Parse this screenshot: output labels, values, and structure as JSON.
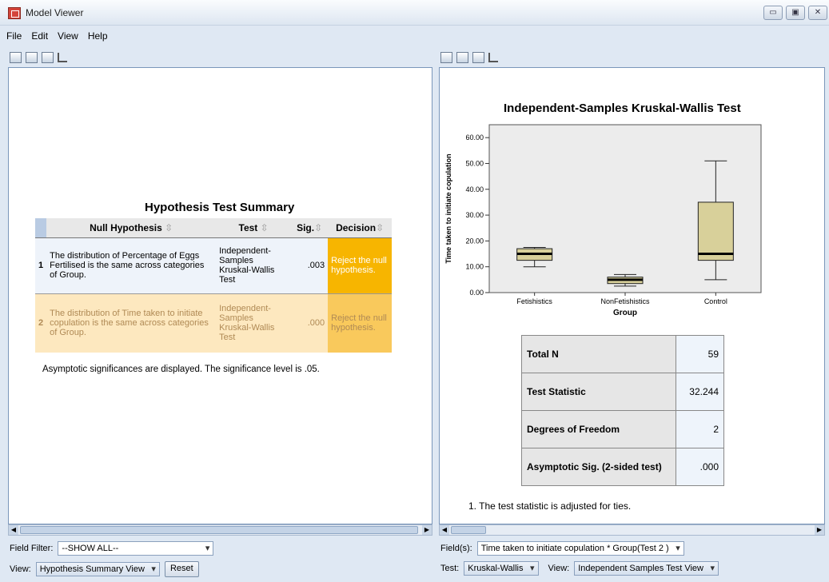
{
  "window": {
    "title": "Model Viewer",
    "controls": [
      "▭",
      "▣",
      "✕"
    ]
  },
  "menu": [
    "File",
    "Edit",
    "View",
    "Help"
  ],
  "left_pane": {
    "table_title": "Hypothesis Test Summary",
    "columns": [
      "Null Hypothesis",
      "Test",
      "Sig.",
      "Decision"
    ],
    "rows": [
      {
        "num": "1",
        "hypothesis": "The distribution of Percentage of Eggs Fertilised is the same across categories of Group.",
        "test": "Independent-Samples Kruskal-Wallis Test",
        "sig": ".003",
        "decision": "Reject the null hypothesis."
      },
      {
        "num": "2",
        "hypothesis": "The distribution of Time taken to initiate copulation is the same across categories of Group.",
        "test": "Independent-Samples Kruskal-Wallis Test",
        "sig": ".000",
        "decision": "Reject the null hypothesis."
      }
    ],
    "note": "Asymptotic significances are displayed.  The significance level is .05.",
    "field_filter_label": "Field Filter:",
    "field_filter_value": "--SHOW ALL--",
    "view_label": "View:",
    "view_value": "Hypothesis Summary View",
    "reset_label": "Reset"
  },
  "right_pane": {
    "chart_title": "Independent-Samples Kruskal-Wallis Test",
    "stats": [
      {
        "label": "Total N",
        "value": "59"
      },
      {
        "label": "Test Statistic",
        "value": "32.244"
      },
      {
        "label": "Degrees of Freedom",
        "value": "2"
      },
      {
        "label": "Asymptotic Sig. (2-sided test)",
        "value": ".000"
      }
    ],
    "footnote": "1.  The test statistic is adjusted for ties.",
    "fields_label": "Field(s):",
    "fields_value": "Time taken to initiate copulation * Group(Test 2 )",
    "test_label": "Test:",
    "test_value": "Kruskal-Wallis",
    "view_label": "View:",
    "view_value": "Independent Samples Test View"
  },
  "chart_data": {
    "type": "box",
    "title": "Independent-Samples Kruskal-Wallis Test",
    "xlabel": "Group",
    "ylabel": "Time taken to initiate copulation",
    "ylim": [
      0,
      65
    ],
    "yticks": [
      "0.00",
      "10.00",
      "20.00",
      "30.00",
      "40.00",
      "50.00",
      "60.00"
    ],
    "ytick_values": [
      0,
      10,
      20,
      30,
      40,
      50,
      60
    ],
    "categories": [
      "Fetishistics",
      "NonFetishistics",
      "Control"
    ],
    "boxes": [
      {
        "min": 10,
        "q1": 12.5,
        "median": 15,
        "q3": 17,
        "max": 17.5
      },
      {
        "min": 2.5,
        "q1": 3.5,
        "median": 5,
        "q3": 6,
        "max": 7
      },
      {
        "min": 5,
        "q1": 12.5,
        "median": 15,
        "q3": 35,
        "max": 51
      }
    ],
    "box_color": "#d8d09a",
    "plot_bg": "#ececec"
  }
}
